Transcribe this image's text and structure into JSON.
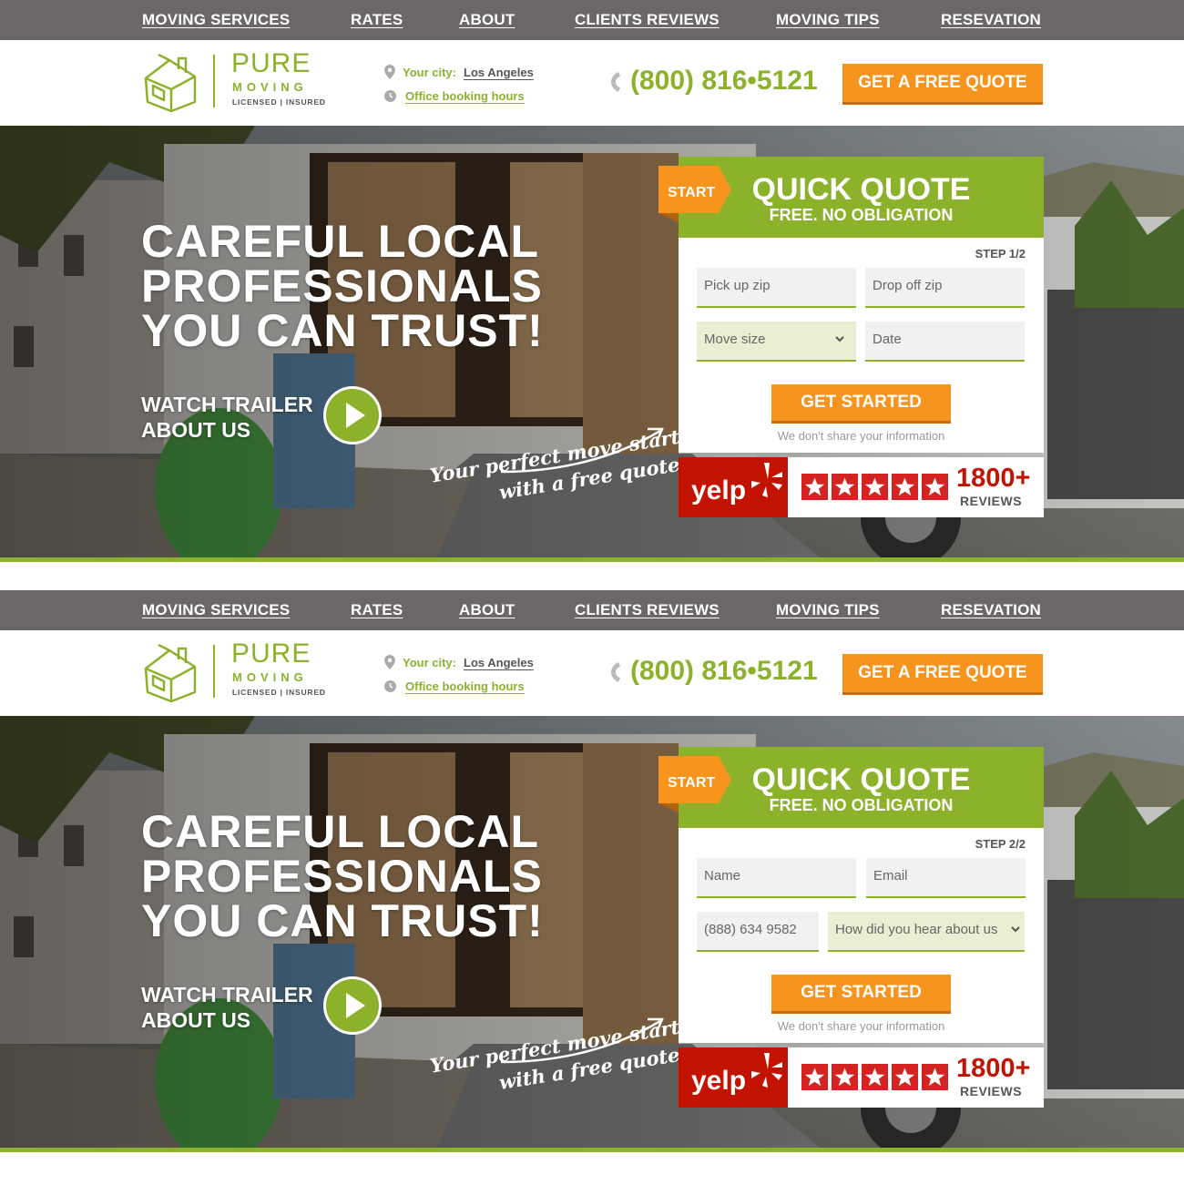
{
  "nav": {
    "items": [
      "MOVING SERVICES",
      "RATES",
      "ABOUT",
      "CLIENTS REVIEWS",
      "MOVING TIPS",
      "RESEVATION"
    ]
  },
  "header": {
    "logo": {
      "name": "PURE",
      "tagline": "MOVING",
      "sub": "LICENSED | INSURED"
    },
    "city_label": "Your city:",
    "city_value": "Los Angeles",
    "hours_link": "Office booking hours",
    "phone": "(800) 816•5121",
    "quote_button": "GET A FREE QUOTE"
  },
  "hero": {
    "headline": [
      "CAREFUL LOCAL",
      "PROFESSIONALS",
      "YOU CAN TRUST!"
    ],
    "trailer": [
      "WATCH TRAILER",
      "ABOUT US"
    ],
    "script": [
      "Your perfect move starts",
      "with a free quote"
    ]
  },
  "quote_card": {
    "start": "START",
    "title": "QUICK QUOTE",
    "subtitle": "FREE. NO OBLIGATION",
    "cta": "GET STARTED",
    "note": "We don't share your information"
  },
  "steps": [
    {
      "step": "STEP 1/2",
      "fields": [
        "Pick up zip",
        "Drop off zip",
        "Move size",
        "Date"
      ]
    },
    {
      "step": "STEP 2/2",
      "fields": [
        "Name",
        "Email",
        "(888) 634 9582",
        "How did you hear about us"
      ]
    }
  ],
  "yelp": {
    "logo": "yelp",
    "count": "1800+",
    "label": "REVIEWS",
    "stars": 5
  },
  "colors": {
    "nav": "#6b6768",
    "green": "#8cb22c",
    "orange": "#f7941d",
    "yelp_red": "#c41200"
  }
}
